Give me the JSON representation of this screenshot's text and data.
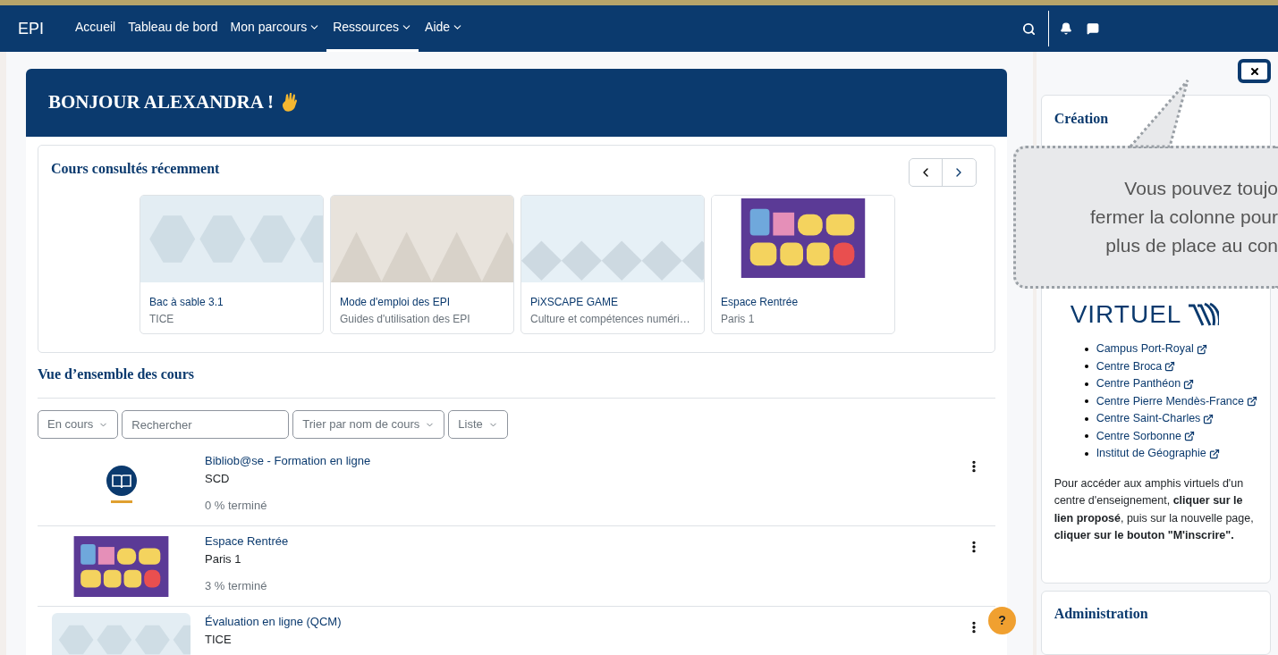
{
  "nav": {
    "brand": "EPI",
    "items": [
      {
        "label": "Accueil",
        "dropdown": false,
        "selected": false
      },
      {
        "label": "Tableau de bord",
        "dropdown": false,
        "selected": false
      },
      {
        "label": "Mon parcours",
        "dropdown": true,
        "selected": false
      },
      {
        "label": "Ressources",
        "dropdown": true,
        "selected": true
      },
      {
        "label": "Aide",
        "dropdown": true,
        "selected": false
      }
    ]
  },
  "greeting": "BONJOUR ALEXANDRA !",
  "recent": {
    "title": "Cours consultés récemment",
    "courses": [
      {
        "name": "Bac à sable 3.1",
        "category": "TICE",
        "kind": "hexagon"
      },
      {
        "name": "Mode d'emploi des EPI",
        "category": "Guides d'utilisation des EPI",
        "kind": "triangle"
      },
      {
        "name": "PiXSCAPE GAME",
        "category": "Culture et compétences numéri…",
        "kind": "diamond"
      },
      {
        "name": "Espace Rentrée",
        "category": "Paris 1",
        "kind": "logo"
      }
    ]
  },
  "overview": {
    "title": "Vue d’ensemble des cours",
    "filters": [
      {
        "kind": "dropdown",
        "label": "En cours"
      },
      {
        "kind": "search",
        "placeholder": "Rechercher"
      },
      {
        "kind": "dropdown",
        "label": "Trier par nom de cours"
      },
      {
        "kind": "dropdown",
        "label": "Liste"
      }
    ],
    "courses": [
      {
        "name": "Bibliob@se - Formation en ligne",
        "category": "SCD",
        "progress": "0 % terminé",
        "kind": "book"
      },
      {
        "name": "Espace Rentrée",
        "category": "Paris 1",
        "progress": "3 % terminé",
        "kind": "logo"
      },
      {
        "name": "Évaluation en ligne (QCM)",
        "category": "TICE",
        "kind": "hexagon"
      }
    ]
  },
  "drawer": {
    "card_title": "Création",
    "logo": "VIRTUEL",
    "links": [
      "Campus Port-Royal",
      "Centre Broca",
      "Centre Panthéon",
      "Centre Pierre Mendès-France",
      "Centre Saint-Charles",
      "Centre Sorbonne",
      "Institut de Géographie"
    ],
    "note": "Pour accéder aux amphis virtuels d'un centre d'enseignement, **cliquer sur le lien proposé**, puis sur la nouvelle page, **cliquer sur le bouton \"M'inscrire\".**",
    "admin_title": "Administration"
  },
  "tooltip": {
    "lines": [
      "Vous pouvez toujo",
      "fermer la colonne pour",
      "plus de place au con"
    ]
  },
  "help": "?"
}
